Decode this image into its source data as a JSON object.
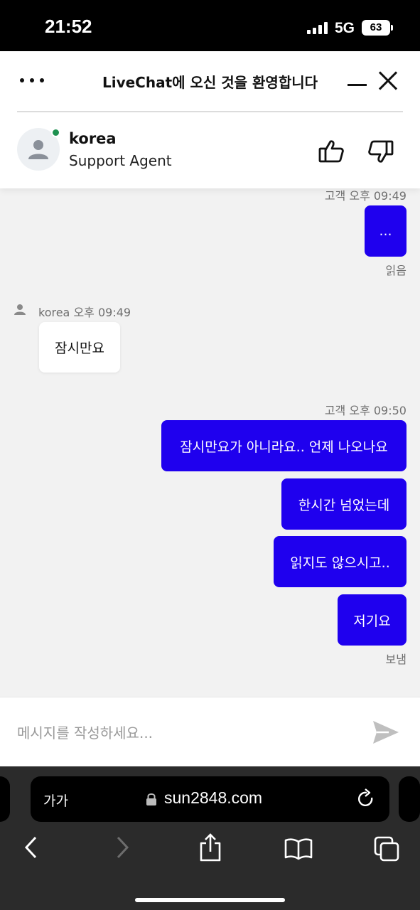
{
  "status_bar": {
    "time": "21:52",
    "network": "5G",
    "battery": "63"
  },
  "chat_header": {
    "title": "LiveChat에 오신 것을 환영합니다",
    "agent_name": "korea",
    "agent_role": "Support Agent"
  },
  "messages": {
    "m1": {
      "meta": "고객 오후 09:49",
      "text": "...",
      "status": "읽음"
    },
    "m2": {
      "meta": "korea 오후 09:49",
      "text": "잠시만요"
    },
    "m3": {
      "meta": "고객 오후 09:50",
      "text": "잠시만요가 아니라요.. 언제 나오나요"
    },
    "m4": {
      "text": "한시간 넘었는데"
    },
    "m5": {
      "text": "읽지도 않으시고.."
    },
    "m6": {
      "text": "저기요",
      "status": "보냄"
    }
  },
  "composer": {
    "placeholder": "메시지를 작성하세요..."
  },
  "browser": {
    "text_size": "가가",
    "url": "sun2848.com"
  },
  "colors": {
    "customer_bubble": "#1f00ee",
    "online": "#1e9150",
    "send_icon": "#bfbfbf"
  }
}
